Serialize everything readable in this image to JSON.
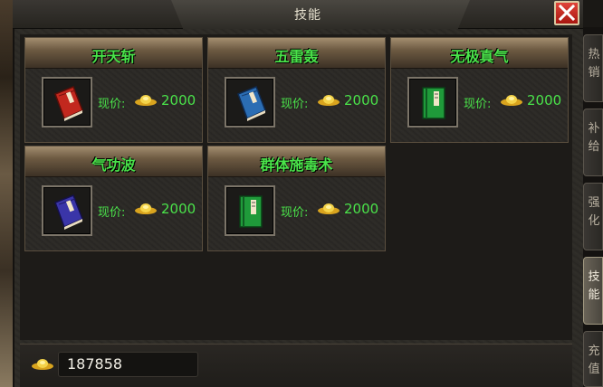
{
  "window": {
    "title": "技能",
    "close_icon": "close-icon"
  },
  "items": [
    {
      "name": "开天斩",
      "price_label": "现价:",
      "price": "2000",
      "book_color": "#c2281e",
      "book_icon": "red-book-icon"
    },
    {
      "name": "五雷轰",
      "price_label": "现价:",
      "price": "2000",
      "book_color": "#2b6db3",
      "book_icon": "blue-book-icon"
    },
    {
      "name": "无极真气",
      "price_label": "现价:",
      "price": "2000",
      "book_color": "#1f9a3a",
      "book_icon": "green-book-icon"
    },
    {
      "name": "气功波",
      "price_label": "现价:",
      "price": "2000",
      "book_color": "#3a35a8",
      "book_icon": "purple-book-icon"
    },
    {
      "name": "群体施毒术",
      "price_label": "现价:",
      "price": "2000",
      "book_color": "#1f9a3a",
      "book_icon": "green-book-icon"
    }
  ],
  "currency": {
    "icon": "gold-ingot-icon",
    "balance": "187858"
  },
  "side_tabs": [
    {
      "label": "热销",
      "active": false
    },
    {
      "label": "补给",
      "active": false
    },
    {
      "label": "强化",
      "active": false
    },
    {
      "label": "技能",
      "active": true
    },
    {
      "label": "充值",
      "active": false
    }
  ],
  "colors": {
    "item_name": "#4ae34a",
    "price_text": "#4ae34a",
    "close_button": "#c8241c"
  }
}
